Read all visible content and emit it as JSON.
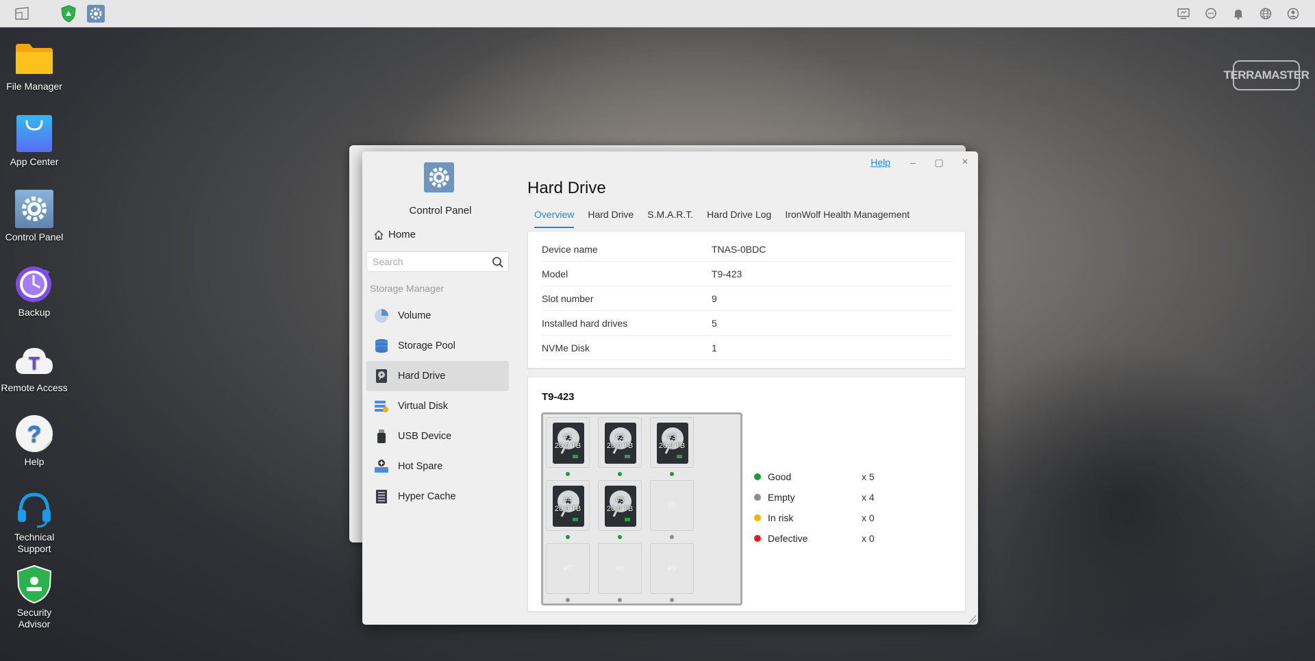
{
  "desktop": {
    "icons": [
      {
        "label": "File Manager",
        "icon": "folder-icon"
      },
      {
        "label": "App Center",
        "icon": "shopping-bag-icon"
      },
      {
        "label": "Control Panel",
        "icon": "gear-icon"
      },
      {
        "label": "Backup",
        "icon": "backup-clock-icon"
      },
      {
        "label": "Remote Access",
        "icon": "cloud-t-icon"
      },
      {
        "label": "Help",
        "icon": "question-icon"
      },
      {
        "label": "Technical Support",
        "icon": "headset-icon"
      },
      {
        "label": "Security Advisor",
        "icon": "shield-icon"
      }
    ],
    "logo_text": "TERRAMASTER"
  },
  "window": {
    "controls": {
      "help": "Help",
      "minimize": "–",
      "maximize": "▢",
      "close": "×"
    },
    "sidebar": {
      "title": "Control Panel",
      "home_label": "Home",
      "search_placeholder": "Search",
      "section_label": "Storage Manager",
      "items": [
        {
          "label": "Volume",
          "icon": "pie-chart-icon",
          "active": false
        },
        {
          "label": "Storage Pool",
          "icon": "database-icon",
          "active": false
        },
        {
          "label": "Hard Drive",
          "icon": "hard-drive-icon",
          "active": true
        },
        {
          "label": "Virtual Disk",
          "icon": "virtual-disk-icon",
          "active": false
        },
        {
          "label": "USB Device",
          "icon": "usb-icon",
          "active": false
        },
        {
          "label": "Hot Spare",
          "icon": "hot-spare-icon",
          "active": false
        },
        {
          "label": "Hyper Cache",
          "icon": "cache-icon",
          "active": false
        }
      ]
    },
    "main": {
      "title": "Hard Drive",
      "tabs": [
        "Overview",
        "Hard Drive",
        "S.M.A.R.T.",
        "Hard Drive Log",
        "IronWolf Health Management"
      ],
      "active_tab": 0,
      "info": [
        {
          "key": "Device name",
          "value": "TNAS-0BDC"
        },
        {
          "key": "Model",
          "value": "T9-423"
        },
        {
          "key": "Slot number",
          "value": "9"
        },
        {
          "key": "Installed hard drives",
          "value": "5"
        },
        {
          "key": "NVMe Disk",
          "value": "1"
        }
      ],
      "device": {
        "title": "T9-423",
        "slots": [
          {
            "id": "#1",
            "size": "20.0 TB",
            "installed": true,
            "status": "good"
          },
          {
            "id": "#2",
            "size": "20.0 TB",
            "installed": true,
            "status": "good"
          },
          {
            "id": "#3",
            "size": "20.0 TB",
            "installed": true,
            "status": "good"
          },
          {
            "id": "#4",
            "size": "20.0 TB",
            "installed": true,
            "status": "good"
          },
          {
            "id": "#5",
            "size": "20.0 TB",
            "installed": true,
            "status": "good"
          },
          {
            "id": "#6",
            "size": "",
            "installed": false,
            "status": "empty"
          },
          {
            "id": "#7",
            "size": "",
            "installed": false,
            "status": "empty"
          },
          {
            "id": "#8",
            "size": "",
            "installed": false,
            "status": "empty"
          },
          {
            "id": "#9",
            "size": "",
            "installed": false,
            "status": "empty"
          }
        ],
        "legend": [
          {
            "name": "Good",
            "count": "x 5",
            "color": "#1e9a2e"
          },
          {
            "name": "Empty",
            "count": "x 4",
            "color": "#8c8c8c"
          },
          {
            "name": "In risk",
            "count": "x 0",
            "color": "#f3b300"
          },
          {
            "name": "Defective",
            "count": "x 0",
            "color": "#e31b1b"
          }
        ]
      }
    }
  },
  "colors": {
    "accent": "#1a8ad8",
    "good": "#1e9a2e",
    "empty": "#8c8c8c"
  }
}
